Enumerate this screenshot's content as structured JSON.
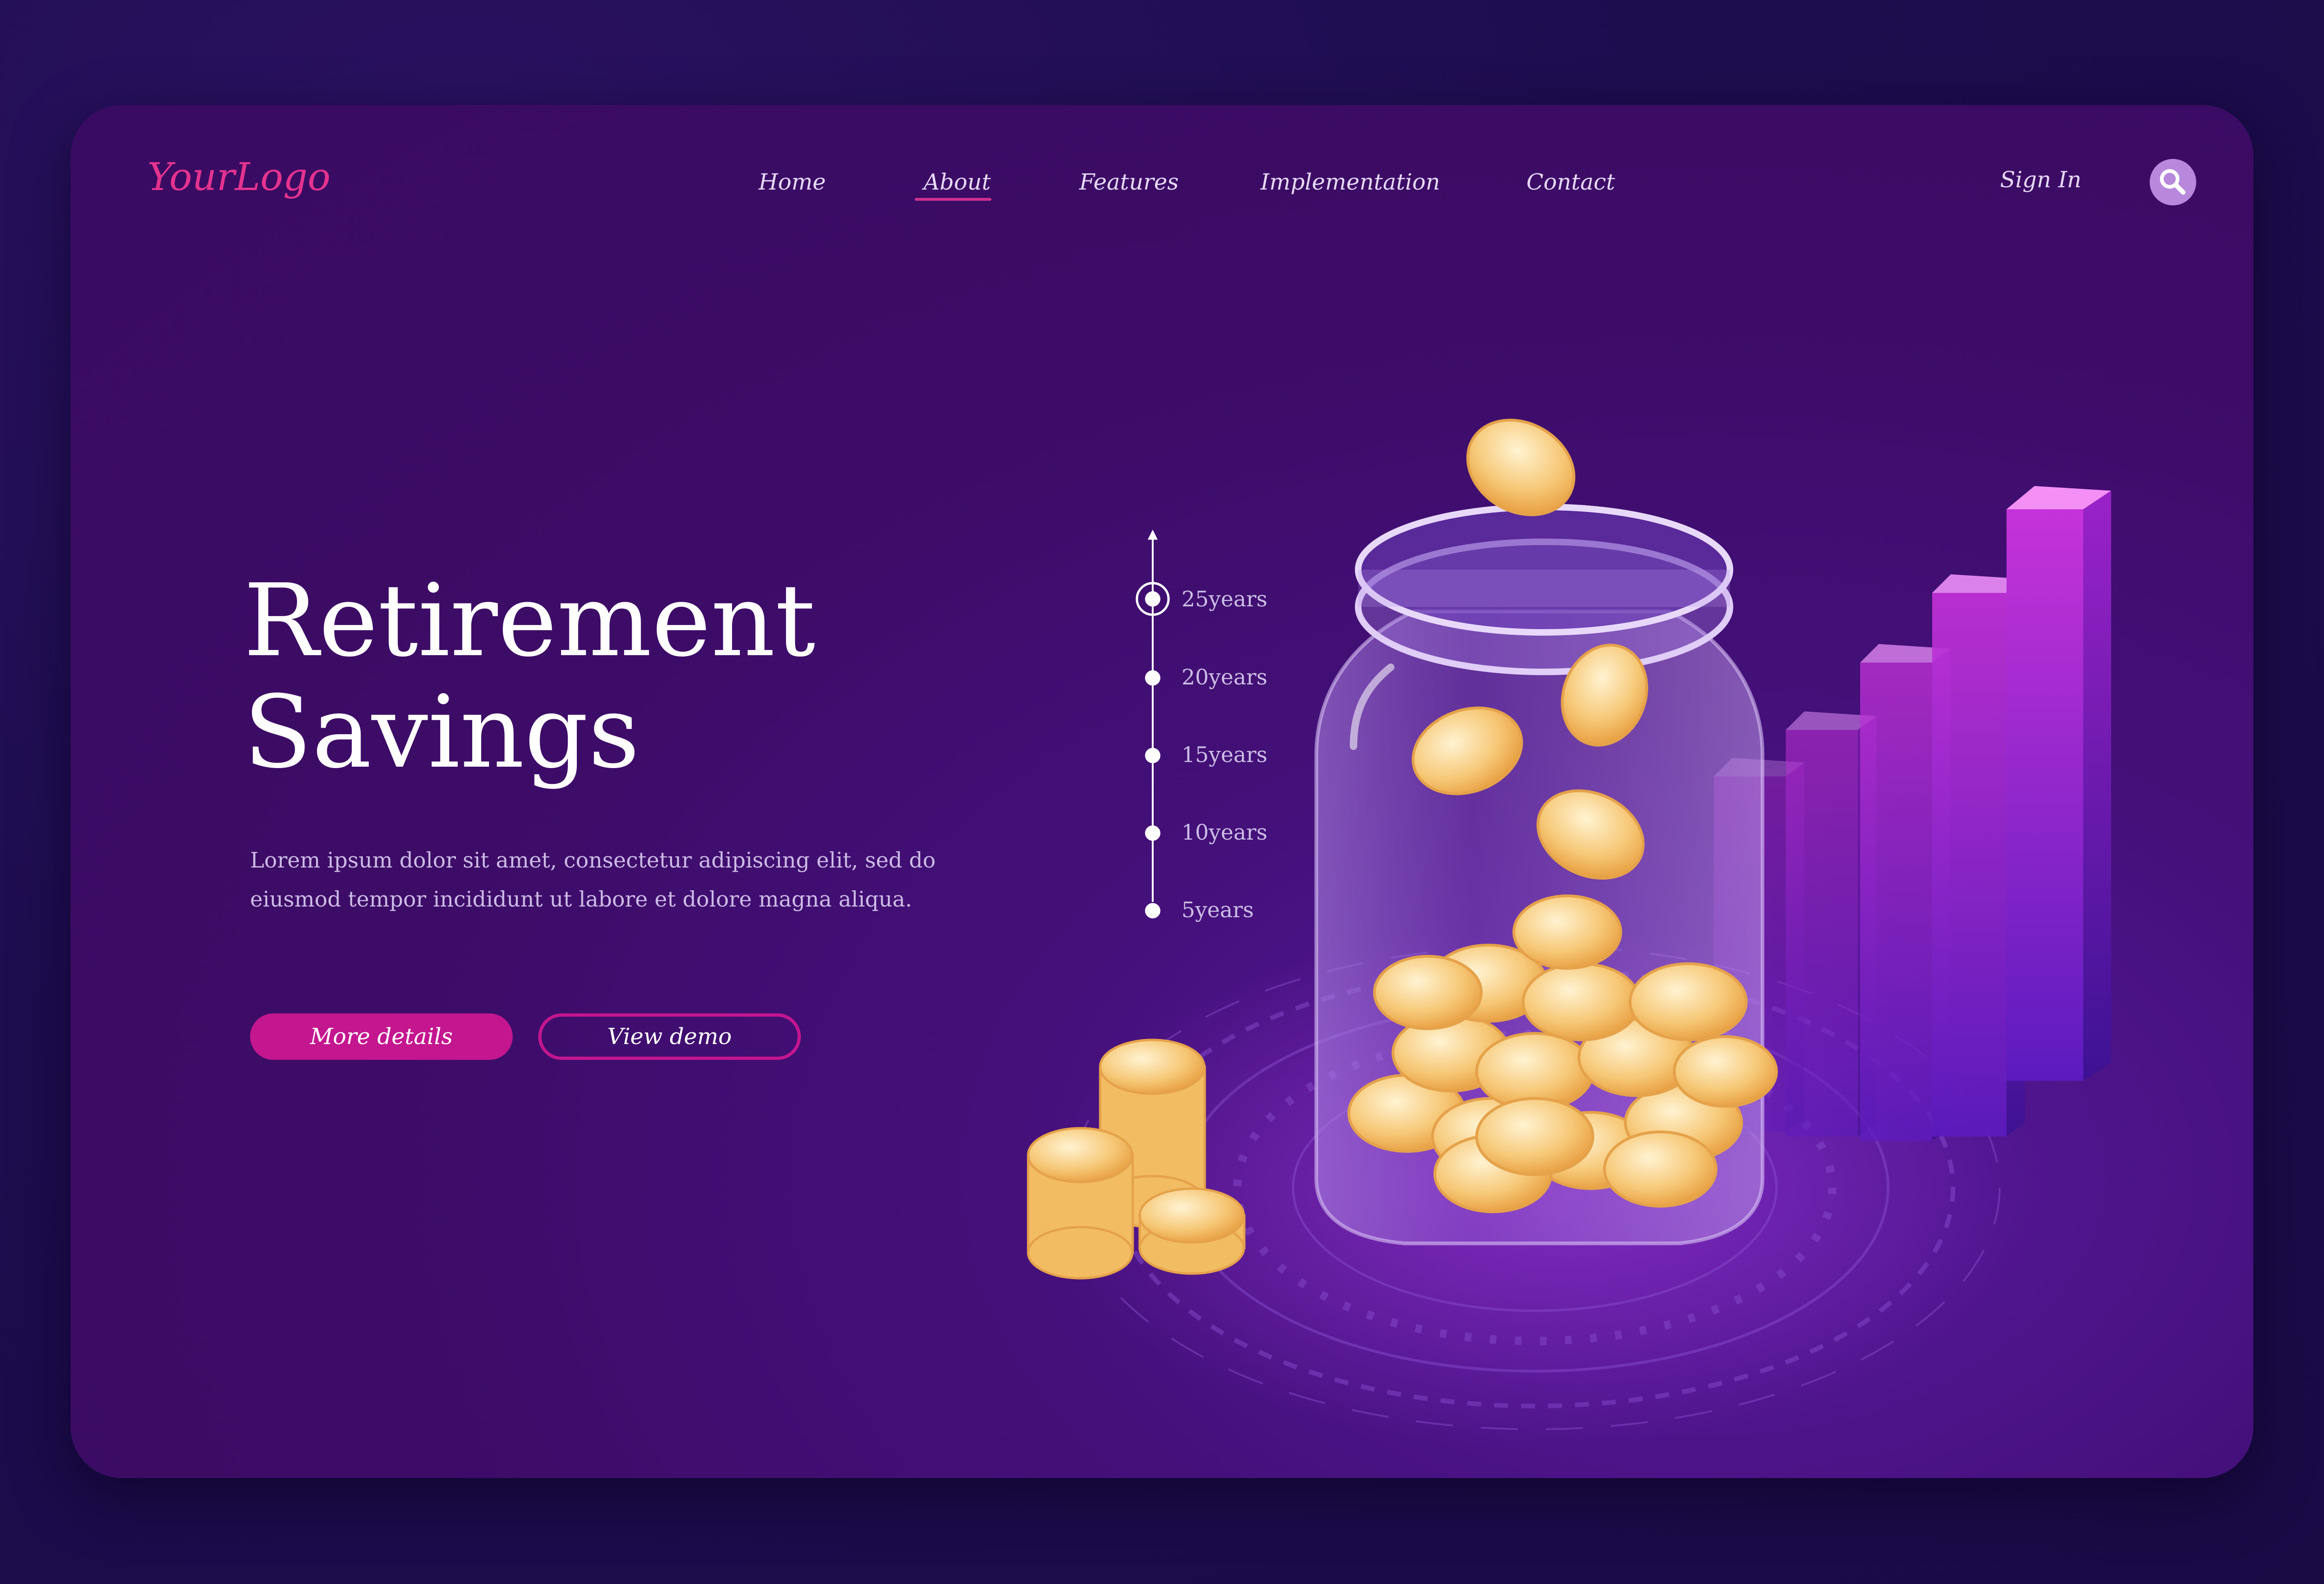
{
  "header": {
    "logo": "YourLogo",
    "nav": [
      {
        "label": "Home",
        "active": false
      },
      {
        "label": "About",
        "active": true
      },
      {
        "label": "Features",
        "active": false
      },
      {
        "label": "Implementation",
        "active": false
      },
      {
        "label": "Contact",
        "active": false
      }
    ],
    "sign_in": "Sign In",
    "search_icon": "search-icon"
  },
  "hero": {
    "title_line1": "Retirement",
    "title_line2": "Savings",
    "description": "Lorem ipsum dolor sit amet, consectetur adipiscing elit, sed do eiusmod tempor incididunt ut labore et dolore magna aliqua.",
    "primary_button": "More details",
    "secondary_button": "View demo"
  },
  "timeline": {
    "labels": [
      "25years",
      "20years",
      "15years",
      "10years",
      "5years"
    ],
    "selected": "25years"
  },
  "colors": {
    "accent": "#c3168f",
    "logo": "#e4338f",
    "background": "#3c0c66",
    "outer_background": "#1d0d4f"
  }
}
